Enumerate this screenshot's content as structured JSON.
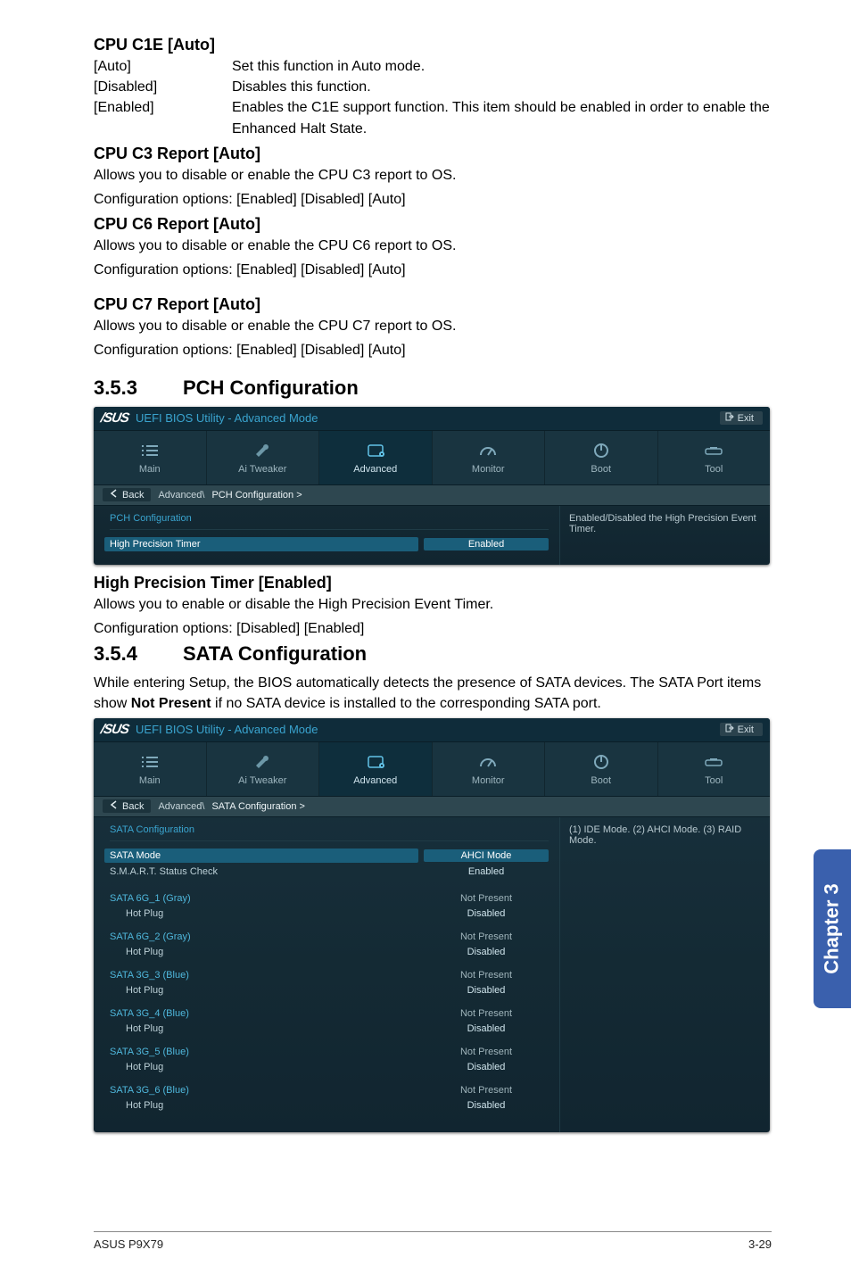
{
  "cpu_c1e": {
    "heading": "CPU C1E [Auto]",
    "rows": [
      {
        "key": "[Auto]",
        "val": "Set this function in Auto mode."
      },
      {
        "key": "[Disabled]",
        "val": "Disables this function."
      },
      {
        "key": "[Enabled]",
        "val": "Enables the C1E support function. This item should be enabled in order to enable the Enhanced Halt State."
      }
    ]
  },
  "cpu_c3": {
    "heading": "CPU C3 Report [Auto]",
    "p1": "Allows you to disable or enable the CPU C3 report to OS.",
    "p2": "Configuration options: [Enabled] [Disabled] [Auto]"
  },
  "cpu_c6": {
    "heading": "CPU C6 Report [Auto]",
    "p1": "Allows you to disable or enable the CPU C6 report to OS.",
    "p2": "Configuration options: [Enabled] [Disabled] [Auto]"
  },
  "cpu_c7": {
    "heading": "CPU C7 Report [Auto]",
    "p1": "Allows you to disable or enable the CPU C7 report to OS.",
    "p2": "Configuration options: [Enabled] [Disabled] [Auto]"
  },
  "sec353": {
    "num": "3.5.3",
    "title": "PCH Configuration"
  },
  "sec354": {
    "num": "3.5.4",
    "title": "SATA Configuration"
  },
  "bios_shared": {
    "brand": "/SUS",
    "title": "UEFI BIOS Utility - Advanced Mode",
    "exit": "Exit",
    "back": "Back",
    "tabs": [
      "Main",
      "Ai  Tweaker",
      "Advanced",
      "Monitor",
      "Boot",
      "Tool"
    ],
    "icon_placeholder": ""
  },
  "bios_pch": {
    "crumb_prefix": "Advanced\\",
    "crumb_item": "PCH Configuration  >",
    "group": "PCH Configuration",
    "row": {
      "label": "High Precision Timer",
      "value": "Enabled"
    },
    "help": "Enabled/Disabled the High Precision Event Timer."
  },
  "hpt": {
    "heading": "High Precision Timer [Enabled]",
    "p1": "Allows you to enable or disable the High Precision Event Timer.",
    "p2": "Configuration options: [Disabled] [Enabled]"
  },
  "sata_intro": "While entering Setup, the BIOS automatically detects the presence of SATA devices. The SATA Port items show Not Present if no SATA device is installed to the corresponding SATA port.",
  "sata_intro_a": "While entering Setup, the BIOS automatically detects the presence of SATA devices. The SATA Port items show ",
  "sata_intro_bold": "Not Present",
  "sata_intro_b": " if no SATA device is installed to the corresponding SATA port.",
  "bios_sata": {
    "crumb_prefix": "Advanced\\",
    "crumb_item": "SATA Configuration  >",
    "group": "SATA Configuration",
    "help": "(1) IDE Mode. (2) AHCI Mode. (3) RAID Mode.",
    "rows": [
      {
        "label": "SATA Mode",
        "value": "AHCI Mode",
        "sel": true
      },
      {
        "label": "S.M.A.R.T. Status Check",
        "value": "Enabled"
      }
    ],
    "ports": [
      {
        "name": "SATA 6G_1 (Gray)",
        "status": "Not Present",
        "hot": "Hot Plug",
        "hotv": "Disabled"
      },
      {
        "name": "SATA 6G_2 (Gray)",
        "status": "Not Present",
        "hot": "Hot Plug",
        "hotv": "Disabled"
      },
      {
        "name": "SATA 3G_3 (Blue)",
        "status": "Not Present",
        "hot": "Hot Plug",
        "hotv": "Disabled"
      },
      {
        "name": "SATA 3G_4 (Blue)",
        "status": "Not Present",
        "hot": "Hot Plug",
        "hotv": "Disabled"
      },
      {
        "name": "SATA 3G_5 (Blue)",
        "status": "Not Present",
        "hot": "Hot Plug",
        "hotv": "Disabled"
      },
      {
        "name": "SATA 3G_6 (Blue)",
        "status": "Not Present",
        "hot": "Hot Plug",
        "hotv": "Disabled"
      }
    ]
  },
  "chapter_tab": "Chapter 3",
  "footer": {
    "left": "ASUS P9X79",
    "right": "3-29"
  },
  "icons": {
    "main": "list-icon",
    "tweaker": "wrench-icon",
    "advanced": "chip-icon",
    "monitor": "gauge-icon",
    "boot": "power-icon",
    "tool": "tool-icon",
    "exit": "exit-icon",
    "back": "back-arrow-icon"
  }
}
